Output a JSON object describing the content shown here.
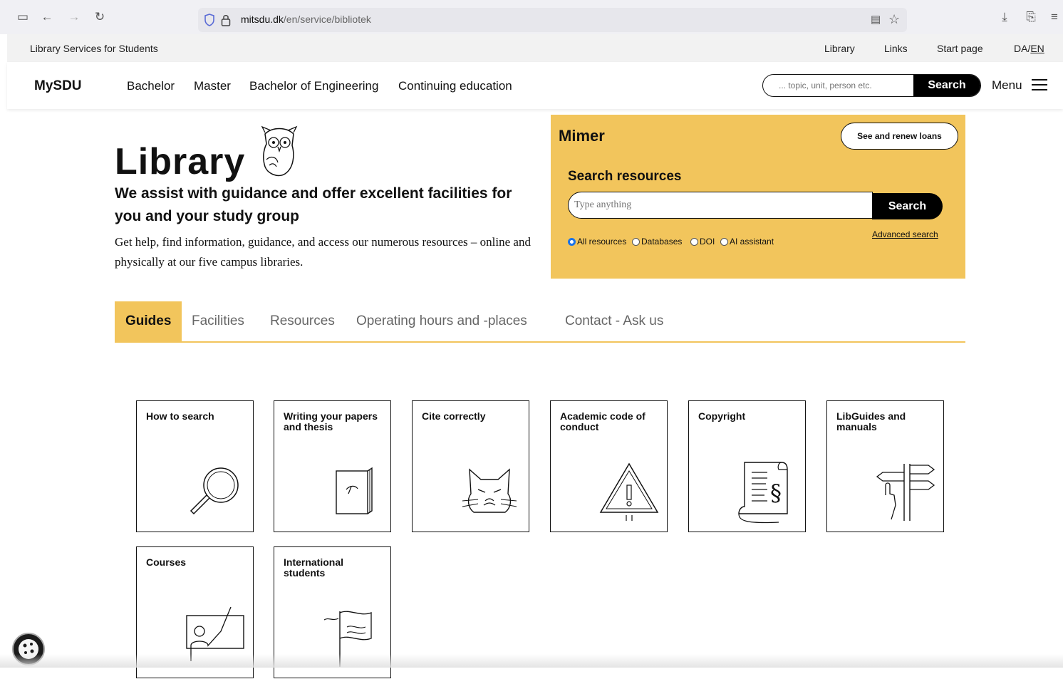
{
  "browser": {
    "url_domain": "mitsdu.dk",
    "url_path": "/en/service/bibliotek"
  },
  "service_bar": {
    "title": "Library Services for Students",
    "links": [
      "Library",
      "Links",
      "Start page"
    ],
    "lang_da": "DA",
    "lang_sep": "/",
    "lang_en": "EN"
  },
  "nav": {
    "logo": "MySDU",
    "items": [
      "Bachelor",
      "Master",
      "Bachelor of Engineering",
      "Continuing education"
    ],
    "search_placeholder": "... topic, unit, person etc.",
    "search_button": "Search",
    "menu_label": "Menu"
  },
  "hero": {
    "title": "Library",
    "subtitle": "We assist with guidance and offer excellent facilities for you and your study group",
    "description": "Get help, find information, guidance, and access our numerous resources – online and physically at our five campus libraries."
  },
  "mimer": {
    "title": "Mimer",
    "loans_button": "See and renew loans",
    "search_title": "Search resources",
    "input_placeholder": "Type anything",
    "search_button": "Search",
    "advanced_search": "Advanced search",
    "radios": [
      {
        "label": "All resources",
        "checked": true
      },
      {
        "label": "Databases",
        "checked": false
      },
      {
        "label": "DOI",
        "checked": false
      },
      {
        "label": "AI assistant",
        "checked": false
      }
    ]
  },
  "tabs": [
    "Guides",
    "Facilities",
    "Resources",
    "Operating hours and -places",
    "Contact - Ask us"
  ],
  "active_tab": "Guides",
  "cards": [
    {
      "label": "How to search",
      "icon": "magnifier-icon"
    },
    {
      "label": "Writing your papers and thesis",
      "icon": "book-icon"
    },
    {
      "label": "Cite correctly",
      "icon": "grumpy-cat-icon"
    },
    {
      "label": "Academic code of conduct",
      "icon": "warning-icon"
    },
    {
      "label": "Copyright",
      "icon": "paragraph-scroll-icon"
    },
    {
      "label": "LibGuides and manuals",
      "icon": "signpost-icon"
    },
    {
      "label": "Courses",
      "icon": "teacher-board-icon"
    },
    {
      "label": "International students",
      "icon": "flag-icon"
    }
  ],
  "colors": {
    "accent": "#f2c55c",
    "black": "#000000"
  }
}
